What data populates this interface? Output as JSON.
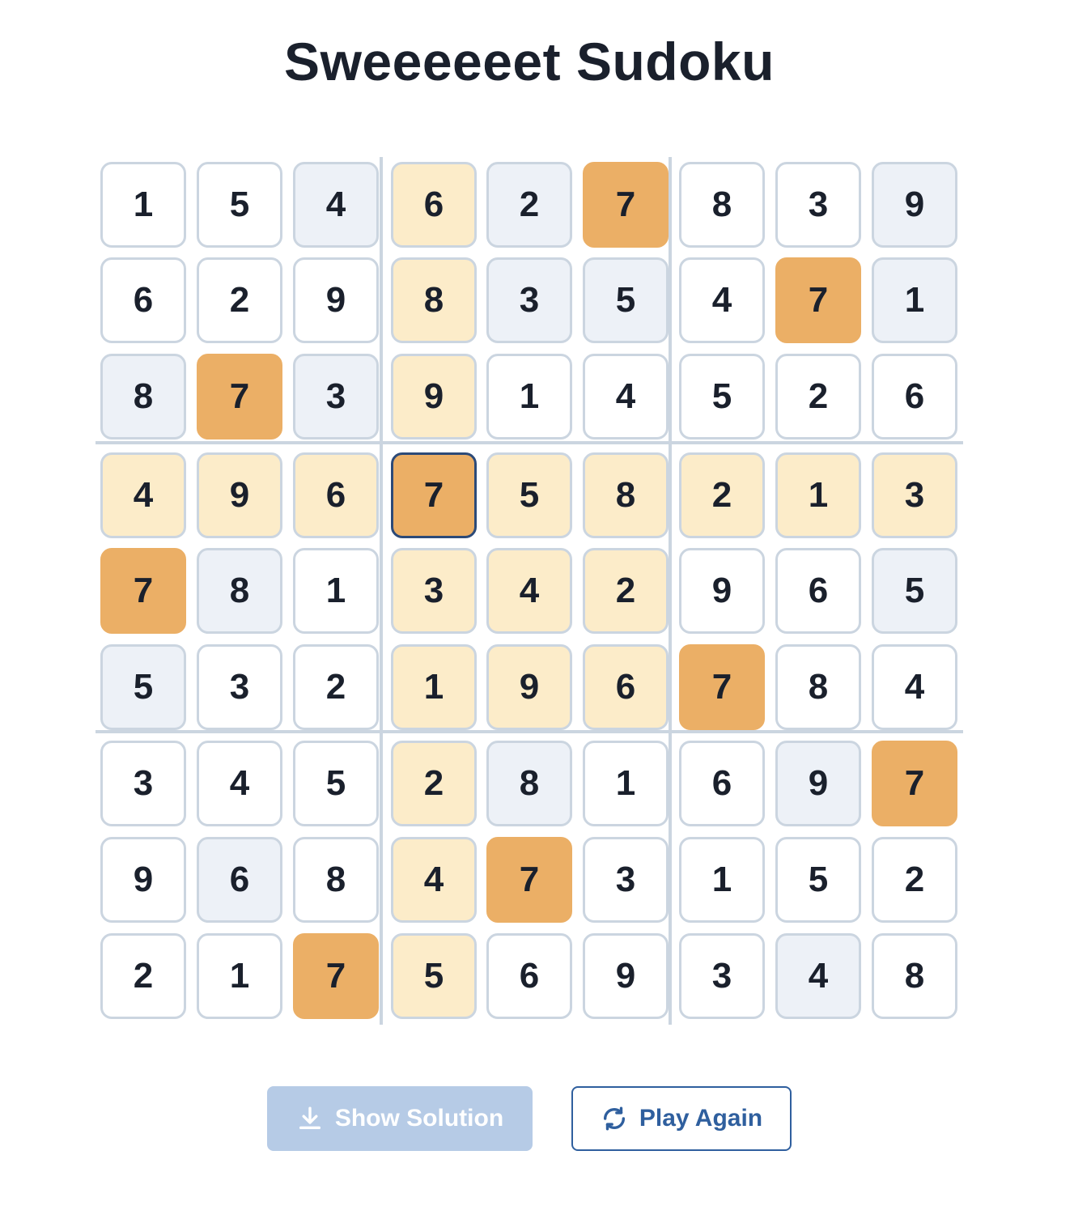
{
  "title": "Sweeeeeet Sudoku",
  "grid": [
    [
      1,
      5,
      4,
      6,
      2,
      7,
      8,
      3,
      9
    ],
    [
      6,
      2,
      9,
      8,
      3,
      5,
      4,
      7,
      1
    ],
    [
      8,
      7,
      3,
      9,
      1,
      4,
      5,
      2,
      6
    ],
    [
      4,
      9,
      6,
      7,
      5,
      8,
      2,
      1,
      3
    ],
    [
      7,
      8,
      1,
      3,
      4,
      2,
      9,
      6,
      5
    ],
    [
      5,
      3,
      2,
      1,
      9,
      6,
      7,
      8,
      4
    ],
    [
      3,
      4,
      5,
      2,
      8,
      1,
      6,
      9,
      7
    ],
    [
      9,
      6,
      8,
      4,
      7,
      3,
      1,
      5,
      2
    ],
    [
      2,
      1,
      7,
      5,
      6,
      9,
      3,
      4,
      8
    ]
  ],
  "cell_states": [
    [
      "none",
      "none",
      "peer",
      "box",
      "peer",
      "same",
      "none",
      "none",
      "peer"
    ],
    [
      "none",
      "none",
      "none",
      "box",
      "peer",
      "peer",
      "none",
      "same",
      "peer"
    ],
    [
      "peer",
      "same",
      "peer",
      "box",
      "none",
      "none",
      "none",
      "none",
      "none"
    ],
    [
      "box",
      "box",
      "box",
      "selected",
      "box",
      "box",
      "box",
      "box",
      "box"
    ],
    [
      "same",
      "peer",
      "none",
      "box",
      "box",
      "box",
      "none",
      "none",
      "peer"
    ],
    [
      "peer",
      "none",
      "none",
      "box",
      "box",
      "box",
      "same",
      "none",
      "none"
    ],
    [
      "none",
      "none",
      "none",
      "box",
      "peer",
      "none",
      "none",
      "peer",
      "same"
    ],
    [
      "none",
      "peer",
      "none",
      "box",
      "same",
      "none",
      "none",
      "none",
      "none"
    ],
    [
      "none",
      "none",
      "same",
      "box",
      "none",
      "none",
      "none",
      "peer",
      "none"
    ]
  ],
  "selected_cell": {
    "row": 4,
    "col": 4,
    "value": 7
  },
  "buttons": {
    "show_solution": {
      "label": "Show Solution",
      "icon": "download-icon",
      "enabled": false
    },
    "play_again": {
      "label": "Play Again",
      "icon": "refresh-icon",
      "enabled": true
    }
  },
  "colors": {
    "text": "#1a202c",
    "cell_border": "#cbd5e0",
    "peer_bg": "#edf1f7",
    "box_bg": "#fcecc9",
    "same_number_bg": "#ebaf66",
    "selected_border": "#2c4a78",
    "primary": "#2f5f9e",
    "disabled_button": "#b6cbe6"
  }
}
